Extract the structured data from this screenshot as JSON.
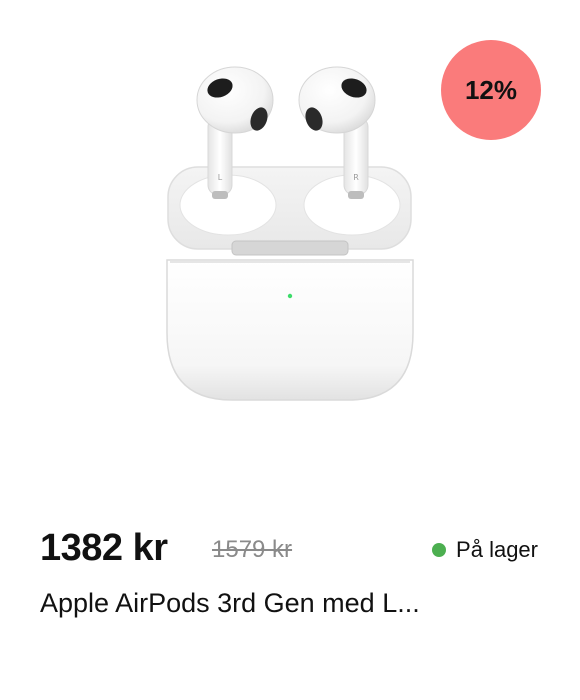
{
  "product": {
    "name": "Apple AirPods 3rd Gen med L...",
    "price": "1382 kr",
    "old_price": "1579 kr",
    "discount_badge": "12%",
    "stock_status": "På lager",
    "image_icon": "airpods-case-image",
    "earbud_left_mark": "L",
    "earbud_right_mark": "R"
  },
  "colors": {
    "badge": "#fa7b7b",
    "stock_dot": "#4caf50",
    "case_led": "#3ddc6a"
  }
}
